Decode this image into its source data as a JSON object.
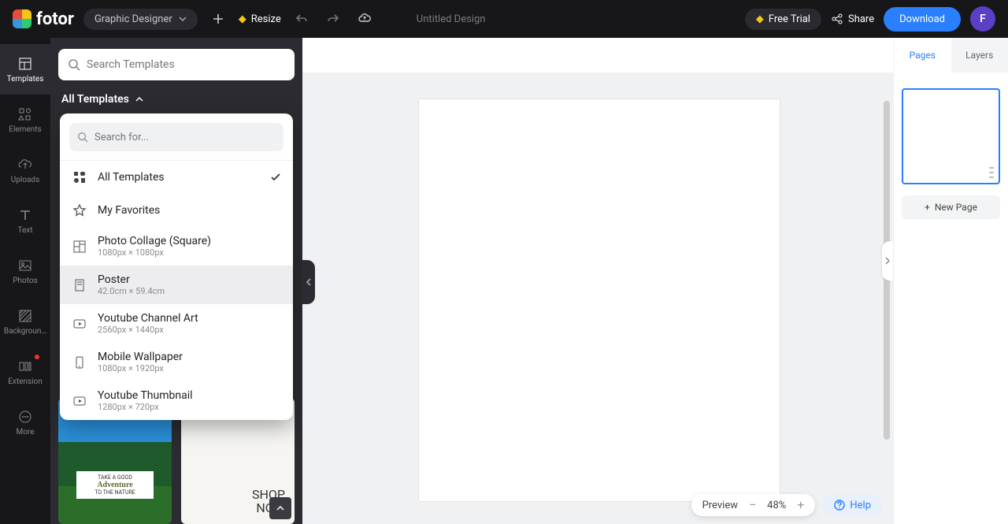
{
  "app": {
    "name": "fotor",
    "mode": "Graphic Designer",
    "title": "Untitled Design"
  },
  "topbar": {
    "resize": "Resize",
    "free_trial": "Free Trial",
    "share": "Share",
    "download": "Download",
    "avatar_initial": "F"
  },
  "leftrail": {
    "templates": "Templates",
    "elements": "Elements",
    "uploads": "Uploads",
    "text": "Text",
    "photos": "Photos",
    "background": "Backgroun…",
    "extension": "Extension",
    "more": "More"
  },
  "panel": {
    "search_placeholder": "Search Templates",
    "heading": "All Templates"
  },
  "dropdown": {
    "search_placeholder": "Search for...",
    "items": [
      {
        "name": "All Templates",
        "dims": "",
        "selected": true,
        "icon": "grid"
      },
      {
        "name": "My Favorites",
        "dims": "",
        "selected": false,
        "icon": "star"
      },
      {
        "name": "Photo Collage (Square)",
        "dims": "1080px × 1080px",
        "selected": false,
        "icon": "collage"
      },
      {
        "name": "Poster",
        "dims": "42.0cm × 59.4cm",
        "selected": false,
        "icon": "poster",
        "hovered": true
      },
      {
        "name": "Youtube Channel Art",
        "dims": "2560px × 1440px",
        "selected": false,
        "icon": "youtube"
      },
      {
        "name": "Mobile Wallpaper",
        "dims": "1080px × 1920px",
        "selected": false,
        "icon": "mobile"
      },
      {
        "name": "Youtube Thumbnail",
        "dims": "1280px × 720px",
        "selected": false,
        "icon": "youtube"
      }
    ]
  },
  "thumbs": {
    "t1_line1": "TAKE A GOOD",
    "t1_line2": "Adventure",
    "t1_line3": "TO THE NATURE",
    "t2_line1": "SHOP",
    "t2_line2": "NOW"
  },
  "rightpanel": {
    "tab_pages": "Pages",
    "tab_layers": "Layers",
    "new_page": "New Page"
  },
  "bottombar": {
    "preview": "Preview",
    "zoom": "48%",
    "help": "Help"
  }
}
